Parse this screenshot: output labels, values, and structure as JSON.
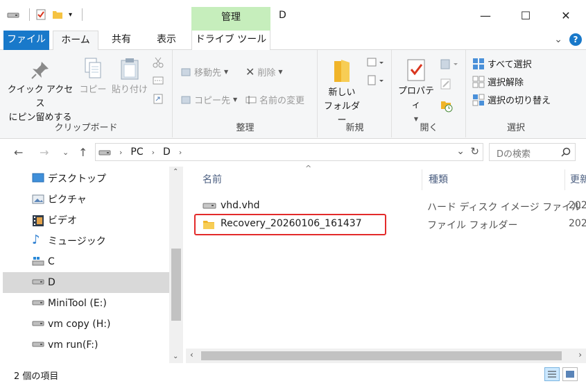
{
  "window": {
    "title": "D",
    "contextual_tab": "管理",
    "minimize": "—",
    "maximize": "☐",
    "close": "✕"
  },
  "tabs": {
    "file": "ファイル",
    "home": "ホーム",
    "share": "共有",
    "view": "表示",
    "drive_tools": "ドライブ ツール",
    "expand": "⌄",
    "help": "?"
  },
  "ribbon": {
    "clipboard": {
      "label": "クリップボード",
      "pin": "クイック アクセス\nにピン留めする",
      "copy": "コピー",
      "paste": "貼り付け"
    },
    "organize": {
      "label": "整理",
      "move_to": "移動先",
      "copy_to": "コピー先",
      "delete": "削除",
      "rename": "名前の変更"
    },
    "new": {
      "label": "新規",
      "new_folder": "新しい\nフォルダー"
    },
    "open": {
      "label": "開く",
      "properties": "プロパティ"
    },
    "select": {
      "label": "選択",
      "select_all": "すべて選択",
      "select_none": "選択解除",
      "invert": "選択の切り替え"
    }
  },
  "address": {
    "path": [
      "PC",
      "D"
    ],
    "search_placeholder": "Dの検索"
  },
  "nav_pane": {
    "items": [
      {
        "label": "デスクトップ",
        "icon": "desktop-icon",
        "selected": false
      },
      {
        "label": "ピクチャ",
        "icon": "pictures-icon",
        "selected": false
      },
      {
        "label": "ビデオ",
        "icon": "videos-icon",
        "selected": false
      },
      {
        "label": "ミュージック",
        "icon": "music-icon",
        "selected": false
      },
      {
        "label": "C",
        "icon": "windows-drive-icon",
        "selected": false
      },
      {
        "label": "D",
        "icon": "drive-icon",
        "selected": true
      },
      {
        "label": "MiniTool (E:)",
        "icon": "drive-icon",
        "selected": false
      },
      {
        "label": "vm copy (H:)",
        "icon": "drive-icon",
        "selected": false
      },
      {
        "label": "vm run(F:)",
        "icon": "drive-icon",
        "selected": false
      }
    ]
  },
  "content": {
    "columns": {
      "name": "名前",
      "type": "種類",
      "date": "更新"
    },
    "files": [
      {
        "name": "vhd.vhd",
        "type": "ハード ディスク イメージ ファイル",
        "date": "202",
        "icon": "disk-image-icon"
      },
      {
        "name": "Recovery_20260106_161437",
        "type": "ファイル フォルダー",
        "date": "202",
        "icon": "folder-icon"
      }
    ]
  },
  "status": {
    "item_count": "2 個の項目"
  },
  "colors": {
    "file_tab": "#1979ca",
    "contextual_tab": "#c6eebc",
    "selection": "#d9d9d9",
    "highlight_box": "#e32a2a"
  }
}
